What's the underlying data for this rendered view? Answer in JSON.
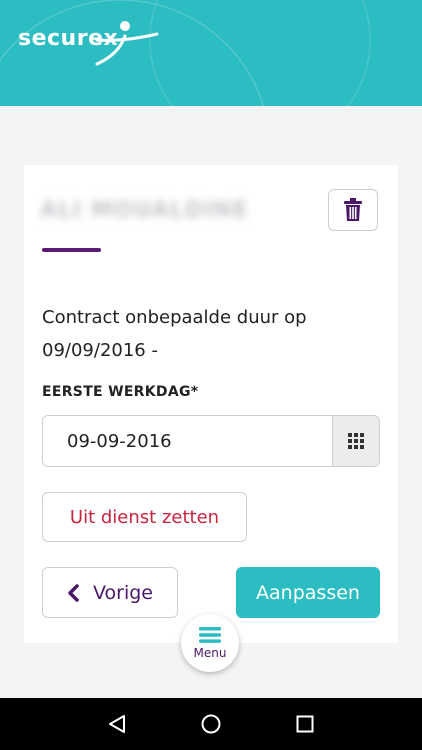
{
  "brand": {
    "name": "securex"
  },
  "employee": {
    "name": "ALI MOUALDINE"
  },
  "contract": {
    "description": "Contract onbepaalde duur op 09/09/2016 -"
  },
  "first_workday": {
    "label": "EERSTE WERKDAG*",
    "value": "09-09-2016"
  },
  "actions": {
    "remove_label": "Uit dienst zetten",
    "back_label": "Vorige",
    "edit_label": "Aanpassen"
  },
  "menu": {
    "label": "Menu"
  },
  "icons": {
    "delete": "trash-icon",
    "calendar": "calendar-grid-icon",
    "back": "chevron-left-icon",
    "menu": "hamburger-icon",
    "nav_back": "triangle-back-icon",
    "nav_home": "circle-home-icon",
    "nav_recent": "square-recent-icon"
  },
  "colors": {
    "brand_teal": "#2bbdc1",
    "accent_purple": "#4a1866",
    "danger_red": "#c8253e"
  }
}
